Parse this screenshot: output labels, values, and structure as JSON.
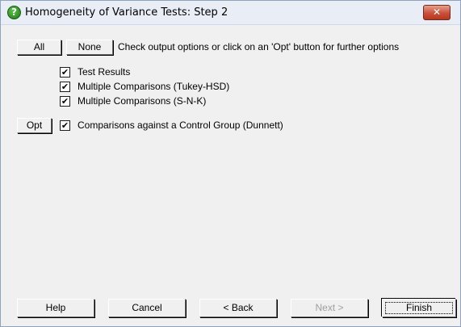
{
  "window": {
    "title": "Homogeneity of Variance Tests: Step 2",
    "close_glyph": "✕",
    "help_icon_glyph": "?"
  },
  "top_buttons": {
    "all_label": "All",
    "none_label": "None"
  },
  "hint": "Check output options or click on an 'Opt' button for further options",
  "options": [
    {
      "label": "Test Results",
      "checked": true,
      "has_opt_button": false
    },
    {
      "label": "Multiple Comparisons (Tukey-HSD)",
      "checked": true,
      "has_opt_button": false
    },
    {
      "label": "Multiple Comparisons (S-N-K)",
      "checked": true,
      "has_opt_button": false
    },
    {
      "label": "Comparisons against a Control Group (Dunnett)",
      "checked": true,
      "has_opt_button": true
    }
  ],
  "check_glyph": "✔",
  "opt_button_label": "Opt",
  "footer": {
    "help_label": "Help",
    "cancel_label": "Cancel",
    "back_label": "< Back",
    "next_label": "Next >",
    "finish_label": "Finish",
    "next_enabled": false
  }
}
